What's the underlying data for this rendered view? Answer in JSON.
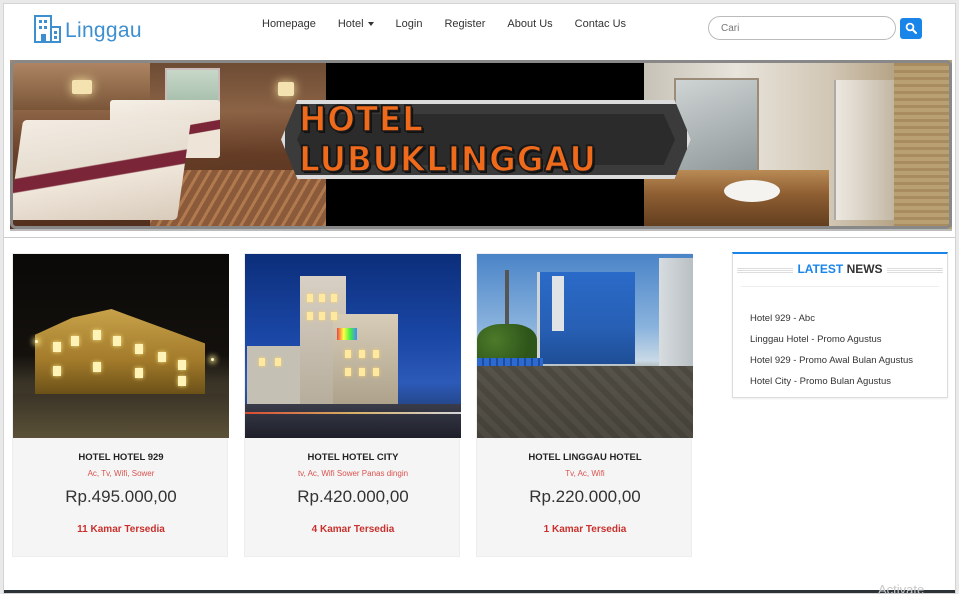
{
  "brand": {
    "name": "Linggau",
    "icon": "hotel-building-icon",
    "color": "#3d8fd0"
  },
  "nav": {
    "items": [
      {
        "label": "Homepage"
      },
      {
        "label": "Hotel",
        "has_dropdown": true
      },
      {
        "label": "Login"
      },
      {
        "label": "Register"
      },
      {
        "label": "About Us"
      },
      {
        "label": "Contac Us"
      }
    ]
  },
  "search": {
    "placeholder": "Cari",
    "button_icon": "search-icon",
    "button_color": "#1a85e8"
  },
  "banner": {
    "title": "HOTEL LUBUKLINGGAU",
    "title_color": "#f06a1c"
  },
  "hotels": [
    {
      "name": "HOTEL HOTEL 929",
      "facilities": "Ac, Tv, Wifi, Sower",
      "price": "Rp.495.000,00",
      "rooms": "11 Kamar Tersedia"
    },
    {
      "name": "HOTEL HOTEL CITY",
      "facilities": "tv, Ac, Wifi Sower Panas dingin",
      "price": "Rp.420.000,00",
      "rooms": "4 Kamar Tersedia"
    },
    {
      "name": "HOTEL LINGGAU HOTEL",
      "facilities": "Tv, Ac, Wifi",
      "price": "Rp.220.000,00",
      "rooms": "1 Kamar Tersedia"
    }
  ],
  "news": {
    "title_accent": "LATEST",
    "title_rest": "NEWS",
    "accent_color": "#1a85e8",
    "items": [
      {
        "label": "Hotel 929 - Abc"
      },
      {
        "label": "Linggau Hotel - Promo Agustus"
      },
      {
        "label": "Hotel 929 - Promo Awal Bulan Agustus"
      },
      {
        "label": "Hotel City - Promo Bulan Agustus"
      }
    ]
  },
  "watermark": "Activate"
}
